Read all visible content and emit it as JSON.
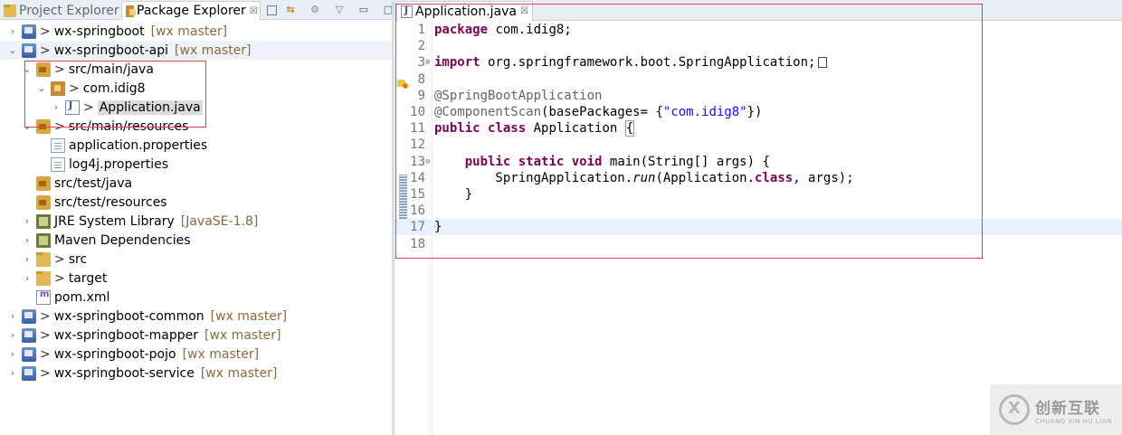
{
  "left_tabs": {
    "project_explorer": "Project Explorer",
    "package_explorer": "Package Explorer",
    "close_glyph": "☒"
  },
  "tree": [
    {
      "indent": 0,
      "twisty": "›",
      "icon": "project-icon",
      "arrow": ">",
      "label": "wx-springboot",
      "branch": "[wx master]"
    },
    {
      "indent": 0,
      "twisty": "⌄",
      "icon": "project-icon",
      "arrow": ">",
      "label": "wx-springboot-api",
      "branch": "[wx master]",
      "selected": true
    },
    {
      "indent": 1,
      "twisty": "⌄",
      "icon": "source-folder-icon",
      "arrow": ">",
      "label": "src/main/java",
      "branch": ""
    },
    {
      "indent": 2,
      "twisty": "⌄",
      "icon": "package-icon",
      "arrow": ">",
      "label": "com.idig8",
      "branch": ""
    },
    {
      "indent": 3,
      "twisty": "›",
      "icon": "java-file-icon",
      "arrow": ">",
      "label": "Application.java",
      "branch": "",
      "highlight": true
    },
    {
      "indent": 1,
      "twisty": "⌄",
      "icon": "source-folder-icon",
      "arrow": ">",
      "label": "src/main/resources",
      "branch": ""
    },
    {
      "indent": 2,
      "twisty": "",
      "icon": "properties-file-icon",
      "arrow": "",
      "label": "application.properties",
      "branch": ""
    },
    {
      "indent": 2,
      "twisty": "",
      "icon": "properties-file-icon",
      "arrow": "",
      "label": "log4j.properties",
      "branch": ""
    },
    {
      "indent": 1,
      "twisty": "",
      "icon": "source-folder-icon",
      "arrow": "",
      "label": "src/test/java",
      "branch": ""
    },
    {
      "indent": 1,
      "twisty": "",
      "icon": "source-folder-icon",
      "arrow": "",
      "label": "src/test/resources",
      "branch": ""
    },
    {
      "indent": 1,
      "twisty": "›",
      "icon": "library-icon",
      "arrow": "",
      "label": "JRE System Library",
      "branch": "[JavaSE-1.8]"
    },
    {
      "indent": 1,
      "twisty": "›",
      "icon": "library-icon",
      "arrow": "",
      "label": "Maven Dependencies",
      "branch": ""
    },
    {
      "indent": 1,
      "twisty": "›",
      "icon": "folder-icon",
      "arrow": ">",
      "label": "src",
      "branch": ""
    },
    {
      "indent": 1,
      "twisty": "›",
      "icon": "folder-icon",
      "arrow": ">",
      "label": "target",
      "branch": ""
    },
    {
      "indent": 1,
      "twisty": "",
      "icon": "xml-file-icon",
      "arrow": "",
      "label": "pom.xml",
      "branch": ""
    },
    {
      "indent": 0,
      "twisty": "›",
      "icon": "project-icon",
      "arrow": ">",
      "label": "wx-springboot-common",
      "branch": "[wx master]"
    },
    {
      "indent": 0,
      "twisty": "›",
      "icon": "project-icon",
      "arrow": ">",
      "label": "wx-springboot-mapper",
      "branch": "[wx master]"
    },
    {
      "indent": 0,
      "twisty": "›",
      "icon": "project-icon",
      "arrow": ">",
      "label": "wx-springboot-pojo",
      "branch": "[wx master]"
    },
    {
      "indent": 0,
      "twisty": "›",
      "icon": "project-icon",
      "arrow": ">",
      "label": "wx-springboot-service",
      "branch": "[wx master]"
    }
  ],
  "editor": {
    "tab_label": "Application.java",
    "close_glyph": "☒",
    "lines": [
      {
        "n": "1",
        "html": "<span class=\"kw\">package</span> com.idig8;"
      },
      {
        "n": "2",
        "html": ""
      },
      {
        "n": "3",
        "fold": "⊕",
        "html": "<span class=\"kw\">import</span> org.springframework.boot.SpringApplication;<span class=\"collapsed\"></span>"
      },
      {
        "n": "8",
        "html": ""
      },
      {
        "n": "9",
        "html": "<span class=\"ann\">@SpringBootApplication</span>"
      },
      {
        "n": "10",
        "html": "<span class=\"ann\">@ComponentScan</span>(basePackages= {<span class=\"str\">\"com.idig8\"</span>})"
      },
      {
        "n": "11",
        "html": "<span class=\"kw\">public</span> <span class=\"kw\">class</span> Application <span class=\"brace-box\">{</span>"
      },
      {
        "n": "12",
        "html": ""
      },
      {
        "n": "13",
        "fold": "⊖",
        "html": "    <span class=\"kw\">public</span> <span class=\"kw\">static</span> <span class=\"kw\">void</span> main(String[] args) {"
      },
      {
        "n": "14",
        "html": "        SpringApplication.<span class=\"italic\">run</span>(Application.<span class=\"kw\">class</span>, args);"
      },
      {
        "n": "15",
        "html": "    }"
      },
      {
        "n": "16",
        "html": ""
      },
      {
        "n": "17",
        "html": "}",
        "current": true
      },
      {
        "n": "18",
        "html": ""
      }
    ]
  },
  "watermark": {
    "cn": "创新互联",
    "en": "CHUANG XIN HU LIAN"
  },
  "colors": {
    "keyword": "#7f0055",
    "annotation": "#646464",
    "string": "#2a00ff",
    "branch": "#8a6a3c",
    "highlight_box": "#e04050"
  }
}
